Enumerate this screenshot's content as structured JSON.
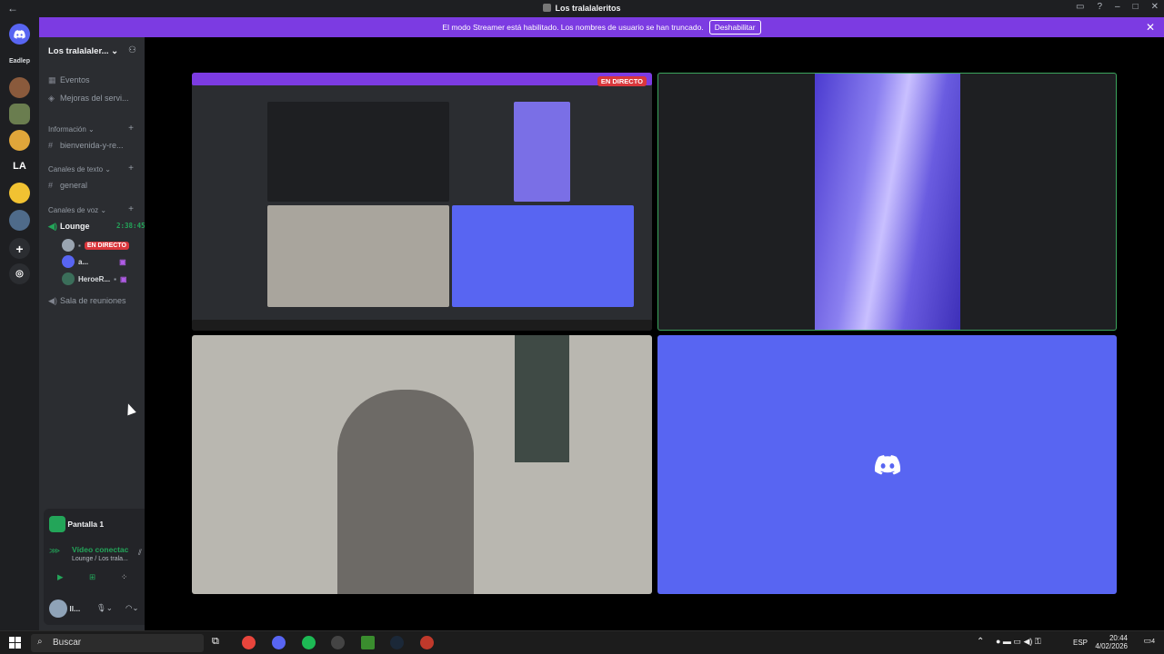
{
  "window": {
    "title": "Los tralalaleritos"
  },
  "banner": {
    "text": "El modo Streamer está habilitado. Los nombres de usuario se han truncado.",
    "button": "Deshabilitar"
  },
  "guilds": [
    {
      "label": "Eadlep"
    },
    {
      "label": "LA"
    }
  ],
  "server": {
    "name": "Los tralalaler..."
  },
  "channels": {
    "top": [
      {
        "label": "Eventos"
      },
      {
        "label": "Mejoras del servi..."
      }
    ],
    "categories": [
      {
        "label": "Información",
        "items": [
          "bienvenida-y-re..."
        ]
      },
      {
        "label": "Canales de texto",
        "items": [
          "general"
        ]
      },
      {
        "label": "Canales de voz"
      }
    ],
    "voice": {
      "name": "Lounge",
      "timer": "2:38:45",
      "users": [
        {
          "name": "",
          "badge": "EN DIRECTO"
        },
        {
          "name": "a..."
        },
        {
          "name": "HeroeR..."
        }
      ],
      "other": "Sala de reuniones"
    }
  },
  "panel": {
    "screen": "Pantalla 1",
    "status": "Vídeo conectac",
    "location": "Lounge / Los trala...",
    "user": "ll..."
  },
  "stage": {
    "live_badge": "EN DIRECTO"
  },
  "taskbar": {
    "search": "Buscar",
    "lang": "ESP",
    "time": "20:44",
    "date": "4/02/2026",
    "notif": "4"
  },
  "colors": {
    "blurple": "#5865f2",
    "banner": "#7c3be2",
    "green": "#23a559",
    "red": "#da373c"
  }
}
